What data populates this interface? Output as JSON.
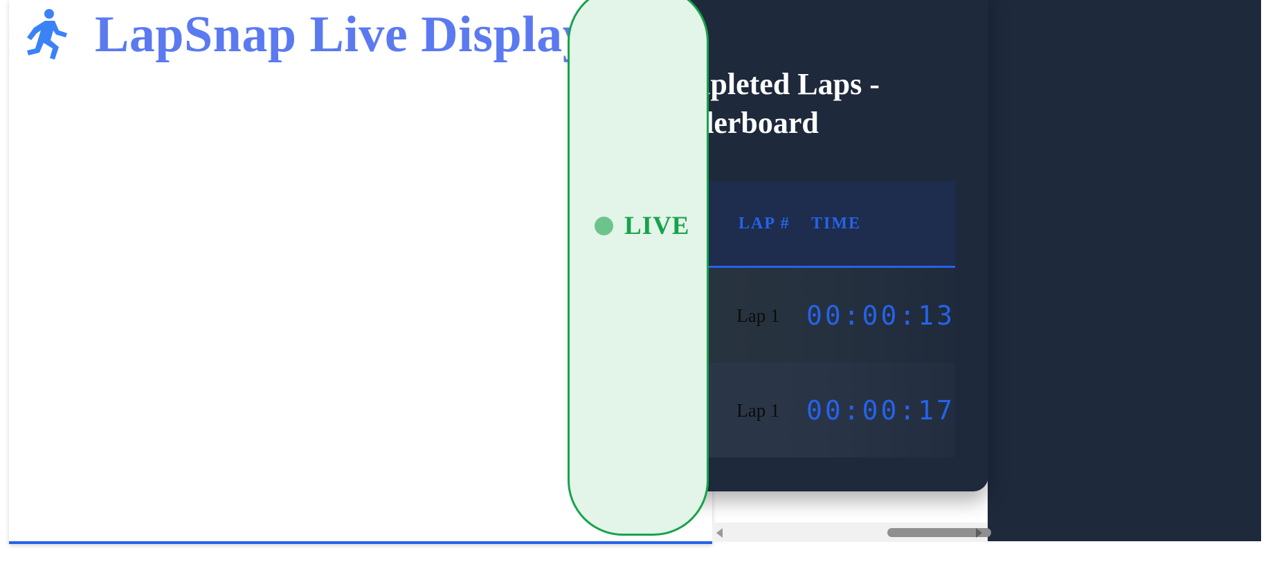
{
  "app": {
    "title": "LapSnap Live Display",
    "icon": "runner-icon",
    "accent_color": "#5b7af0"
  },
  "live_badge": {
    "label": "LIVE",
    "color": "#16a34a",
    "dot_color": "#6cc48c"
  },
  "scoreboard": {
    "title": "Completed Laps - Leaderboard",
    "header_color": "#2563eb",
    "columns": {
      "lap": "LAP #",
      "time": "TIME"
    },
    "rows": [
      {
        "lap": "Lap 1",
        "time": "00:00:13"
      },
      {
        "lap": "Lap 1",
        "time": "00:00:17"
      }
    ]
  },
  "colors": {
    "panel_dark": "#1e293b",
    "border_blue": "#2563eb"
  }
}
